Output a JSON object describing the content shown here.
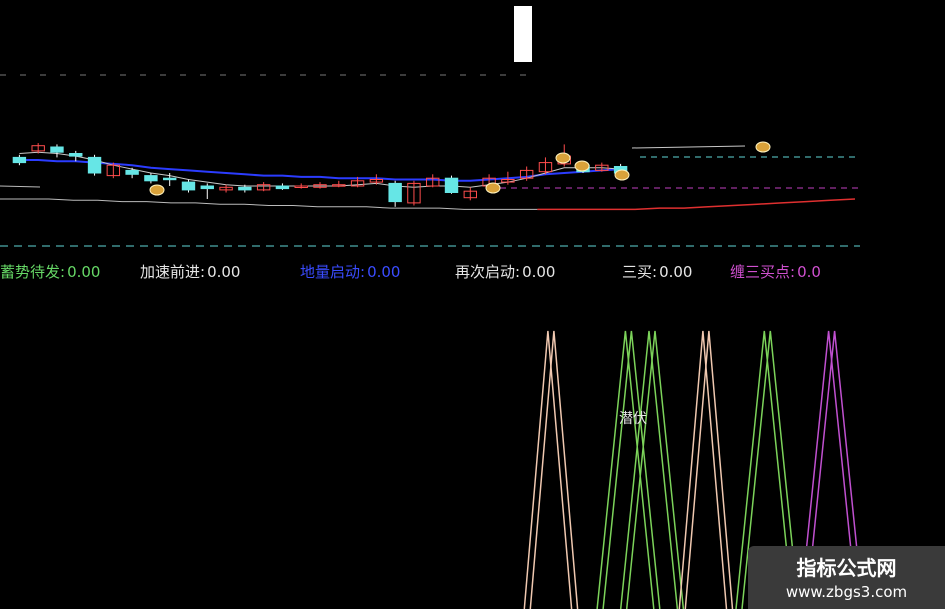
{
  "colors": {
    "background": "#000000",
    "up_candle": "#ff4d4d",
    "down_candle": "#66e6e6",
    "ma_blue": "#2b3cff",
    "ma_gray": "#c8c8c8",
    "ma_red": "#e03030",
    "dash_cyan": "#5fd6d6",
    "dash_magenta": "#c040c0",
    "sig_green": "#7cd35a",
    "sig_peach": "#f0c8b0",
    "sig_magenta": "#c050d0"
  },
  "indicators": [
    {
      "name": "蓄势待发",
      "value": "0.00",
      "color": "#66d866"
    },
    {
      "name": "加速前进",
      "value": "0.00",
      "color": "#e6e6e6"
    },
    {
      "name": "地量启动",
      "value": "0.00",
      "color": "#3a4cff"
    },
    {
      "name": "再次启动",
      "value": "0.00",
      "color": "#e6e6e6"
    },
    {
      "name": "三买",
      "value": "0.00",
      "color": "#e6e6e6"
    },
    {
      "name": "缠三买点",
      "value": "0.0",
      "color": "#d050d0"
    }
  ],
  "signal_label": "潜伏",
  "watermark": {
    "title": "指标公式网",
    "url": "www.zbgs3.com"
  },
  "chart_data": {
    "type": "candlestick",
    "title": "",
    "candles": [
      {
        "o": 0.52,
        "c": 0.48,
        "h": 0.54,
        "l": 0.46
      },
      {
        "o": 0.57,
        "c": 0.61,
        "h": 0.63,
        "l": 0.55
      },
      {
        "o": 0.6,
        "c": 0.56,
        "h": 0.62,
        "l": 0.52
      },
      {
        "o": 0.55,
        "c": 0.53,
        "h": 0.57,
        "l": 0.49
      },
      {
        "o": 0.52,
        "c": 0.4,
        "h": 0.54,
        "l": 0.38
      },
      {
        "o": 0.38,
        "c": 0.46,
        "h": 0.48,
        "l": 0.36
      },
      {
        "o": 0.42,
        "c": 0.39,
        "h": 0.44,
        "l": 0.36
      },
      {
        "o": 0.38,
        "c": 0.34,
        "h": 0.4,
        "l": 0.32
      },
      {
        "o": 0.36,
        "c": 0.35,
        "h": 0.4,
        "l": 0.3
      },
      {
        "o": 0.33,
        "c": 0.27,
        "h": 0.35,
        "l": 0.25
      },
      {
        "o": 0.3,
        "c": 0.28,
        "h": 0.32,
        "l": 0.2
      },
      {
        "o": 0.27,
        "c": 0.29,
        "h": 0.31,
        "l": 0.25
      },
      {
        "o": 0.29,
        "c": 0.27,
        "h": 0.31,
        "l": 0.25
      },
      {
        "o": 0.27,
        "c": 0.31,
        "h": 0.33,
        "l": 0.26
      },
      {
        "o": 0.3,
        "c": 0.28,
        "h": 0.32,
        "l": 0.27
      },
      {
        "o": 0.29,
        "c": 0.3,
        "h": 0.32,
        "l": 0.28
      },
      {
        "o": 0.29,
        "c": 0.31,
        "h": 0.33,
        "l": 0.28
      },
      {
        "o": 0.31,
        "c": 0.31,
        "h": 0.34,
        "l": 0.29
      },
      {
        "o": 0.3,
        "c": 0.34,
        "h": 0.37,
        "l": 0.29
      },
      {
        "o": 0.33,
        "c": 0.35,
        "h": 0.39,
        "l": 0.31
      },
      {
        "o": 0.32,
        "c": 0.18,
        "h": 0.34,
        "l": 0.14
      },
      {
        "o": 0.17,
        "c": 0.32,
        "h": 0.34,
        "l": 0.15
      },
      {
        "o": 0.3,
        "c": 0.36,
        "h": 0.39,
        "l": 0.29
      },
      {
        "o": 0.36,
        "c": 0.25,
        "h": 0.38,
        "l": 0.24
      },
      {
        "o": 0.21,
        "c": 0.26,
        "h": 0.29,
        "l": 0.19
      },
      {
        "o": 0.3,
        "c": 0.36,
        "h": 0.39,
        "l": 0.29
      },
      {
        "o": 0.33,
        "c": 0.35,
        "h": 0.41,
        "l": 0.31
      },
      {
        "o": 0.36,
        "c": 0.42,
        "h": 0.45,
        "l": 0.34
      },
      {
        "o": 0.41,
        "c": 0.48,
        "h": 0.52,
        "l": 0.39
      },
      {
        "o": 0.47,
        "c": 0.53,
        "h": 0.62,
        "l": 0.45
      },
      {
        "o": 0.46,
        "c": 0.41,
        "h": 0.48,
        "l": 0.4
      },
      {
        "o": 0.42,
        "c": 0.46,
        "h": 0.48,
        "l": 0.41
      },
      {
        "o": 0.45,
        "c": 0.4,
        "h": 0.47,
        "l": 0.39
      }
    ],
    "ma_short": [
      0.55,
      0.56,
      0.55,
      0.53,
      0.5,
      0.46,
      0.43,
      0.4,
      0.38,
      0.35,
      0.33,
      0.31,
      0.3,
      0.3,
      0.3,
      0.3,
      0.3,
      0.3,
      0.31,
      0.32,
      0.3,
      0.29,
      0.3,
      0.3,
      0.29,
      0.31,
      0.33,
      0.36,
      0.4,
      0.44,
      0.44,
      0.44,
      0.43
    ],
    "ma_mid": [
      0.5,
      0.5,
      0.49,
      0.49,
      0.48,
      0.47,
      0.46,
      0.44,
      0.43,
      0.42,
      0.41,
      0.4,
      0.39,
      0.38,
      0.38,
      0.37,
      0.37,
      0.36,
      0.36,
      0.36,
      0.35,
      0.35,
      0.35,
      0.34,
      0.34,
      0.35,
      0.36,
      0.37,
      0.39,
      0.4,
      0.41,
      0.42,
      0.43
    ],
    "ma_long": [
      0.2,
      0.2,
      0.2,
      0.19,
      0.19,
      0.18,
      0.18,
      0.17,
      0.17,
      0.16,
      0.16,
      0.15,
      0.15,
      0.14,
      0.14,
      0.14,
      0.13,
      0.13,
      0.13,
      0.12,
      0.12,
      0.12,
      0.12,
      0.12,
      0.12,
      0.12,
      0.12,
      0.13,
      0.13,
      0.14,
      0.15,
      0.16,
      0.17,
      0.18,
      0.19,
      0.2
    ],
    "signal_peaks": [
      {
        "center": 0.583,
        "width": 0.025,
        "color": "#f0c8b0"
      },
      {
        "center": 0.665,
        "width": 0.03,
        "color": "#7cd35a"
      },
      {
        "center": 0.69,
        "width": 0.03,
        "color": "#7cd35a"
      },
      {
        "center": 0.747,
        "width": 0.025,
        "color": "#f0c8b0"
      },
      {
        "center": 0.812,
        "width": 0.03,
        "color": "#7cd35a"
      },
      {
        "center": 0.88,
        "width": 0.03,
        "color": "#c050d0"
      }
    ]
  }
}
